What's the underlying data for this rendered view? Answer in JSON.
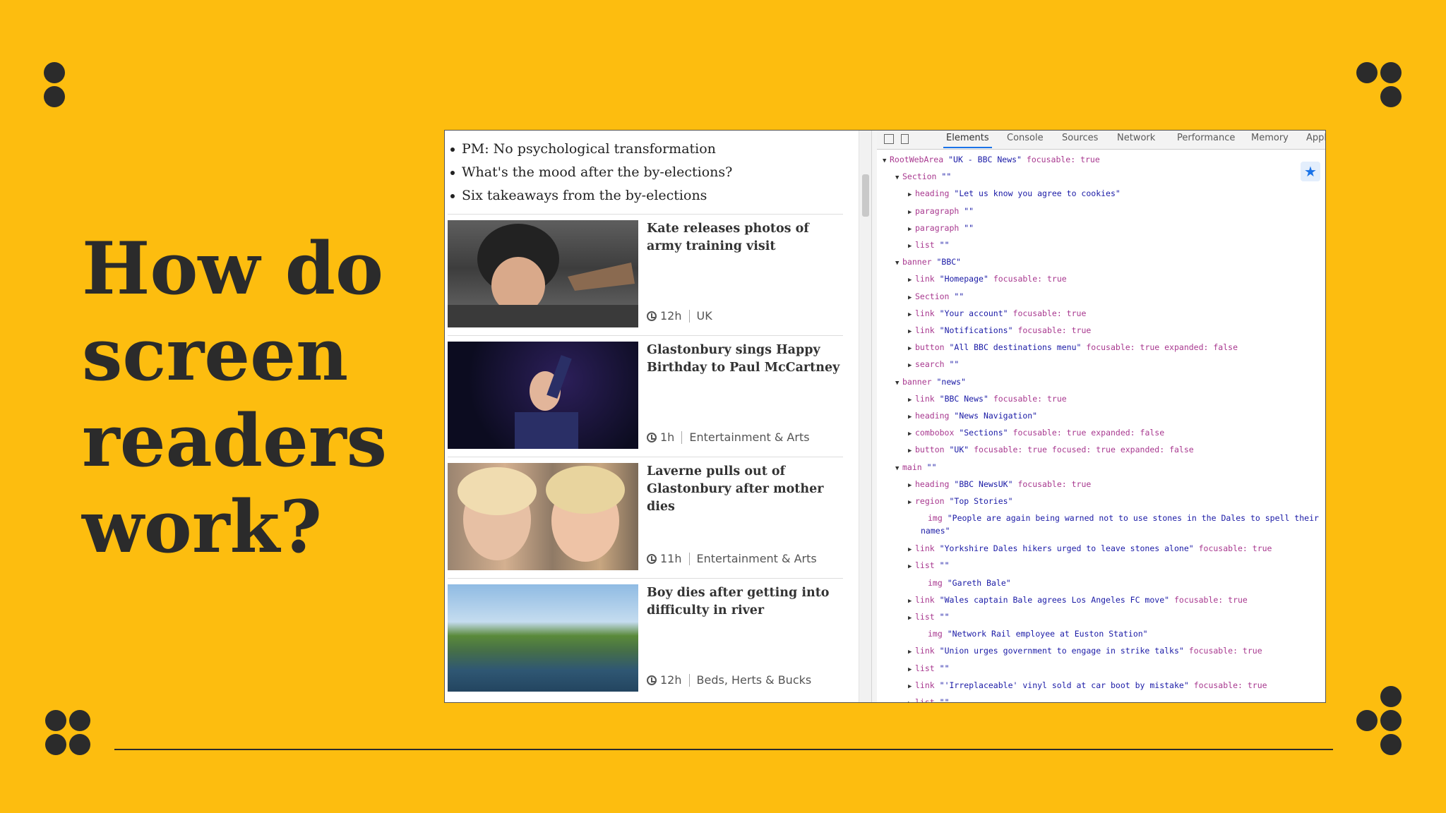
{
  "slide": {
    "title_lines": [
      "How do",
      "screen",
      "readers",
      "work?"
    ]
  },
  "news": {
    "bullets": [
      "PM: No psychological transformation",
      "What's the mood after the by-elections?",
      "Six takeaways from the by-elections"
    ],
    "articles": [
      {
        "title": "Kate releases photos of army training visit",
        "time": "12h",
        "section": "UK"
      },
      {
        "title": "Glastonbury sings Happy Birthday to Paul McCartney",
        "time": "1h",
        "section": "Entertainment & Arts"
      },
      {
        "title": "Laverne pulls out of Glastonbury after mother dies",
        "time": "11h",
        "section": "Entertainment & Arts"
      },
      {
        "title": "Boy dies after getting into difficulty in river",
        "time": "12h",
        "section": "Beds, Herts & Bucks"
      }
    ]
  },
  "devtools": {
    "tabs": [
      "Elements",
      "Console",
      "Sources",
      "Network",
      "Performance",
      "Memory",
      "Appl"
    ],
    "active_tab": "Elements",
    "tree": [
      {
        "caret": "▼",
        "role": "RootWebArea",
        "name": "\"UK - BBC News\"",
        "props": "focusable: true"
      },
      {
        "caret": "▼",
        "role": "Section",
        "name": "\"\"",
        "props": ""
      },
      {
        "caret": "▶",
        "role": "heading",
        "name": "\"Let us know you agree to cookies\"",
        "props": ""
      },
      {
        "caret": "▶",
        "role": "paragraph",
        "name": "\"\"",
        "props": ""
      },
      {
        "caret": "▶",
        "role": "paragraph",
        "name": "\"\"",
        "props": ""
      },
      {
        "caret": "▶",
        "role": "list",
        "name": "\"\"",
        "props": ""
      },
      {
        "caret": "▼",
        "role": "banner",
        "name": "\"BBC\"",
        "props": ""
      },
      {
        "caret": "▶",
        "role": "link",
        "name": "\"Homepage\"",
        "props": "focusable: true"
      },
      {
        "caret": "▶",
        "role": "Section",
        "name": "\"\"",
        "props": ""
      },
      {
        "caret": "▶",
        "role": "link",
        "name": "\"Your account\"",
        "props": "focusable: true"
      },
      {
        "caret": "▶",
        "role": "link",
        "name": "\"Notifications\"",
        "props": "focusable: true"
      },
      {
        "caret": "▶",
        "role": "button",
        "name": "\"All BBC destinations menu\"",
        "props": "focusable: true expanded: false"
      },
      {
        "caret": "▶",
        "role": "search",
        "name": "\"\"",
        "props": ""
      },
      {
        "caret": "▼",
        "role": "banner",
        "name": "\"news\"",
        "props": ""
      },
      {
        "caret": "▶",
        "role": "link",
        "name": "\"BBC News\"",
        "props": "focusable: true"
      },
      {
        "caret": "▶",
        "role": "heading",
        "name": "\"News Navigation\"",
        "props": ""
      },
      {
        "caret": "▶",
        "role": "combobox",
        "name": "\"Sections\"",
        "props": "focusable: true expanded: false"
      },
      {
        "caret": "▶",
        "role": "button",
        "name": "\"UK\"",
        "props": "focusable: true focused: true expanded: false"
      },
      {
        "caret": "▼",
        "role": "main",
        "name": "\"\"",
        "props": ""
      },
      {
        "caret": "▶",
        "role": "heading",
        "name": "\"BBC NewsUK\"",
        "props": "focusable: true"
      },
      {
        "caret": "▶",
        "role": "region",
        "name": "\"Top Stories\"",
        "props": ""
      },
      {
        "caret": "",
        "role": "img",
        "name": "\"People are again being warned not to use stones in the Dales to spell their names\"",
        "props": ""
      },
      {
        "caret": "▶",
        "role": "link",
        "name": "\"Yorkshire Dales hikers urged to leave stones alone\"",
        "props": "focusable: true"
      },
      {
        "caret": "▶",
        "role": "list",
        "name": "\"\"",
        "props": ""
      },
      {
        "caret": "",
        "role": "img",
        "name": "\"Gareth Bale\"",
        "props": ""
      },
      {
        "caret": "▶",
        "role": "link",
        "name": "\"Wales captain Bale agrees Los Angeles FC move\"",
        "props": "focusable: true"
      },
      {
        "caret": "▶",
        "role": "list",
        "name": "\"\"",
        "props": ""
      },
      {
        "caret": "",
        "role": "img",
        "name": "\"Network Rail employee at Euston Station\"",
        "props": ""
      },
      {
        "caret": "▶",
        "role": "link",
        "name": "\"Union urges government to engage in strike talks\"",
        "props": "focusable: true"
      },
      {
        "caret": "▶",
        "role": "list",
        "name": "\"\"",
        "props": ""
      },
      {
        "caret": "▶",
        "role": "link",
        "name": "\"'Irreplaceable' vinyl sold at car boot by mistake\"",
        "props": "focusable: true"
      },
      {
        "caret": "▶",
        "role": "list",
        "name": "\"\"",
        "props": ""
      }
    ]
  }
}
